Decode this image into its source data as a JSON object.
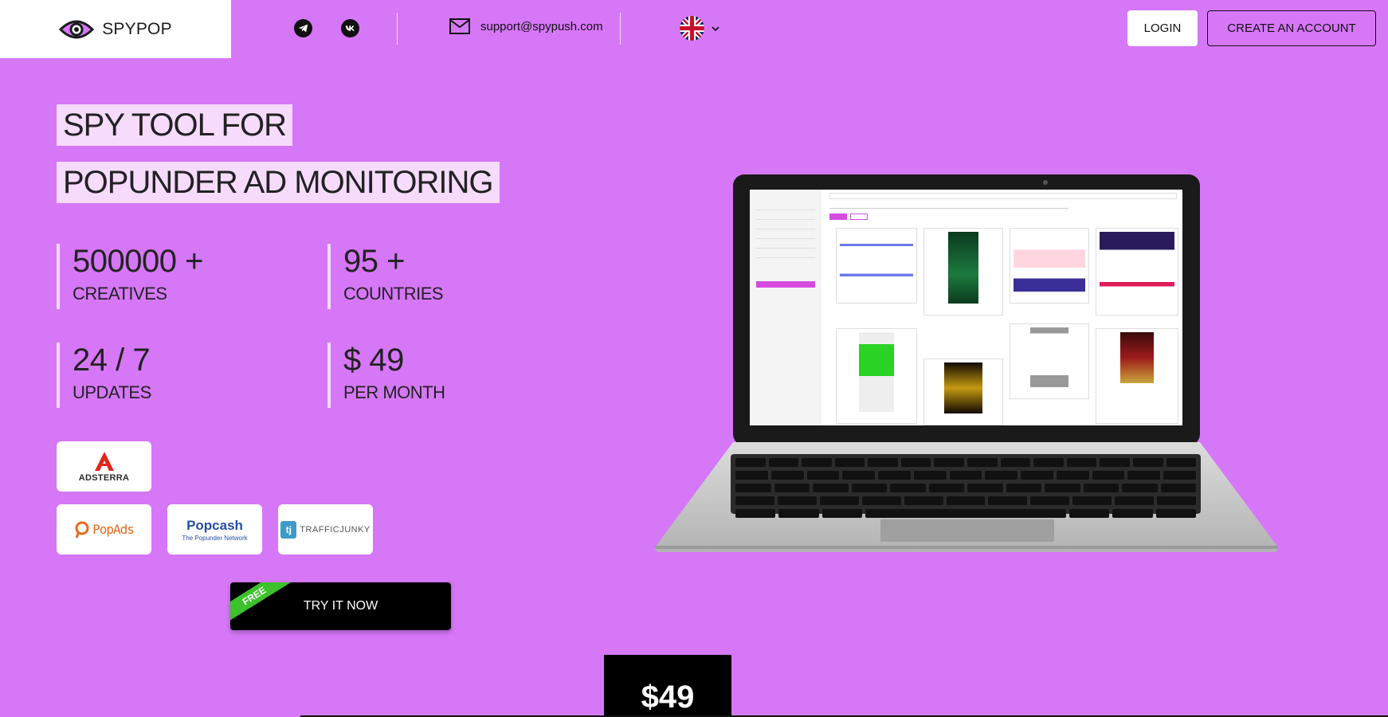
{
  "header": {
    "brand": "SPYPOP",
    "social": [
      {
        "icon": "telegram-icon"
      },
      {
        "icon": "vk-icon"
      }
    ],
    "email": "support@spypush.com",
    "language_flag": "uk-flag-icon",
    "login_label": "LOGIN",
    "create_account_label": "CREATE AN ACCOUNT"
  },
  "hero": {
    "title_line1": "SPY TOOL FOR",
    "title_line2": "POPUNDER AD MONITORING",
    "stats": [
      {
        "value": "500000 +",
        "label": "CREATIVES"
      },
      {
        "value": "95 +",
        "label": "COUNTRIES"
      },
      {
        "value": "24 / 7",
        "label": "UPDATES"
      },
      {
        "value": "$ 49",
        "label": "PER MONTH"
      }
    ]
  },
  "networks": {
    "adsterra": "ADSTERRA",
    "popads": "PopAds",
    "popcash": "Popcash",
    "popcash_sub": "The Popunder Network",
    "trafficjunky": "TRAFFICJUNKY"
  },
  "cta": {
    "label": "TRY IT NOW",
    "ribbon": "FREE"
  },
  "pricing": {
    "price": "$49"
  },
  "colors": {
    "background": "#d677f8",
    "highlight": "#f6dbfd",
    "ribbon": "#3dc12c"
  }
}
